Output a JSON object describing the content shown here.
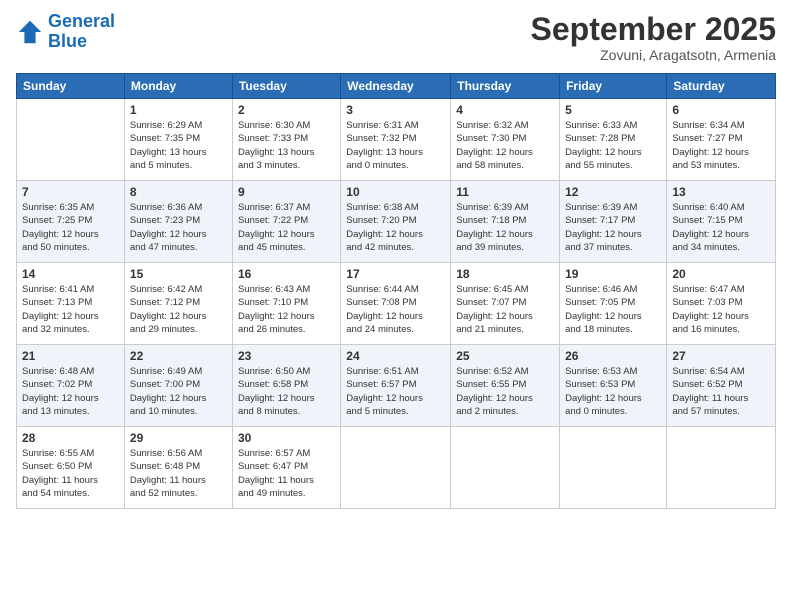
{
  "header": {
    "logo_line1": "General",
    "logo_line2": "Blue",
    "month_title": "September 2025",
    "subtitle": "Zovuni, Aragatsotn, Armenia"
  },
  "days_of_week": [
    "Sunday",
    "Monday",
    "Tuesday",
    "Wednesday",
    "Thursday",
    "Friday",
    "Saturday"
  ],
  "weeks": [
    [
      {
        "date": "",
        "info": ""
      },
      {
        "date": "1",
        "info": "Sunrise: 6:29 AM\nSunset: 7:35 PM\nDaylight: 13 hours\nand 5 minutes."
      },
      {
        "date": "2",
        "info": "Sunrise: 6:30 AM\nSunset: 7:33 PM\nDaylight: 13 hours\nand 3 minutes."
      },
      {
        "date": "3",
        "info": "Sunrise: 6:31 AM\nSunset: 7:32 PM\nDaylight: 13 hours\nand 0 minutes."
      },
      {
        "date": "4",
        "info": "Sunrise: 6:32 AM\nSunset: 7:30 PM\nDaylight: 12 hours\nand 58 minutes."
      },
      {
        "date": "5",
        "info": "Sunrise: 6:33 AM\nSunset: 7:28 PM\nDaylight: 12 hours\nand 55 minutes."
      },
      {
        "date": "6",
        "info": "Sunrise: 6:34 AM\nSunset: 7:27 PM\nDaylight: 12 hours\nand 53 minutes."
      }
    ],
    [
      {
        "date": "7",
        "info": "Sunrise: 6:35 AM\nSunset: 7:25 PM\nDaylight: 12 hours\nand 50 minutes."
      },
      {
        "date": "8",
        "info": "Sunrise: 6:36 AM\nSunset: 7:23 PM\nDaylight: 12 hours\nand 47 minutes."
      },
      {
        "date": "9",
        "info": "Sunrise: 6:37 AM\nSunset: 7:22 PM\nDaylight: 12 hours\nand 45 minutes."
      },
      {
        "date": "10",
        "info": "Sunrise: 6:38 AM\nSunset: 7:20 PM\nDaylight: 12 hours\nand 42 minutes."
      },
      {
        "date": "11",
        "info": "Sunrise: 6:39 AM\nSunset: 7:18 PM\nDaylight: 12 hours\nand 39 minutes."
      },
      {
        "date": "12",
        "info": "Sunrise: 6:39 AM\nSunset: 7:17 PM\nDaylight: 12 hours\nand 37 minutes."
      },
      {
        "date": "13",
        "info": "Sunrise: 6:40 AM\nSunset: 7:15 PM\nDaylight: 12 hours\nand 34 minutes."
      }
    ],
    [
      {
        "date": "14",
        "info": "Sunrise: 6:41 AM\nSunset: 7:13 PM\nDaylight: 12 hours\nand 32 minutes."
      },
      {
        "date": "15",
        "info": "Sunrise: 6:42 AM\nSunset: 7:12 PM\nDaylight: 12 hours\nand 29 minutes."
      },
      {
        "date": "16",
        "info": "Sunrise: 6:43 AM\nSunset: 7:10 PM\nDaylight: 12 hours\nand 26 minutes."
      },
      {
        "date": "17",
        "info": "Sunrise: 6:44 AM\nSunset: 7:08 PM\nDaylight: 12 hours\nand 24 minutes."
      },
      {
        "date": "18",
        "info": "Sunrise: 6:45 AM\nSunset: 7:07 PM\nDaylight: 12 hours\nand 21 minutes."
      },
      {
        "date": "19",
        "info": "Sunrise: 6:46 AM\nSunset: 7:05 PM\nDaylight: 12 hours\nand 18 minutes."
      },
      {
        "date": "20",
        "info": "Sunrise: 6:47 AM\nSunset: 7:03 PM\nDaylight: 12 hours\nand 16 minutes."
      }
    ],
    [
      {
        "date": "21",
        "info": "Sunrise: 6:48 AM\nSunset: 7:02 PM\nDaylight: 12 hours\nand 13 minutes."
      },
      {
        "date": "22",
        "info": "Sunrise: 6:49 AM\nSunset: 7:00 PM\nDaylight: 12 hours\nand 10 minutes."
      },
      {
        "date": "23",
        "info": "Sunrise: 6:50 AM\nSunset: 6:58 PM\nDaylight: 12 hours\nand 8 minutes."
      },
      {
        "date": "24",
        "info": "Sunrise: 6:51 AM\nSunset: 6:57 PM\nDaylight: 12 hours\nand 5 minutes."
      },
      {
        "date": "25",
        "info": "Sunrise: 6:52 AM\nSunset: 6:55 PM\nDaylight: 12 hours\nand 2 minutes."
      },
      {
        "date": "26",
        "info": "Sunrise: 6:53 AM\nSunset: 6:53 PM\nDaylight: 12 hours\nand 0 minutes."
      },
      {
        "date": "27",
        "info": "Sunrise: 6:54 AM\nSunset: 6:52 PM\nDaylight: 11 hours\nand 57 minutes."
      }
    ],
    [
      {
        "date": "28",
        "info": "Sunrise: 6:55 AM\nSunset: 6:50 PM\nDaylight: 11 hours\nand 54 minutes."
      },
      {
        "date": "29",
        "info": "Sunrise: 6:56 AM\nSunset: 6:48 PM\nDaylight: 11 hours\nand 52 minutes."
      },
      {
        "date": "30",
        "info": "Sunrise: 6:57 AM\nSunset: 6:47 PM\nDaylight: 11 hours\nand 49 minutes."
      },
      {
        "date": "",
        "info": ""
      },
      {
        "date": "",
        "info": ""
      },
      {
        "date": "",
        "info": ""
      },
      {
        "date": "",
        "info": ""
      }
    ]
  ]
}
